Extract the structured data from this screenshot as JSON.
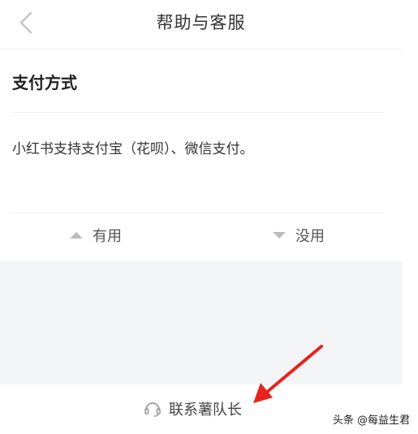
{
  "header": {
    "title": "帮助与客服"
  },
  "article": {
    "title": "支付方式",
    "body": "小红书支持支付宝（花呗）、微信支付。"
  },
  "feedback": {
    "useful_label": "有用",
    "useless_label": "没用"
  },
  "contact": {
    "label": "联系薯队长"
  },
  "watermark": {
    "text": "头条 @每益生君"
  },
  "colors": {
    "accent_arrow": "#e8231f",
    "gray_band": "#f4f5f7"
  }
}
